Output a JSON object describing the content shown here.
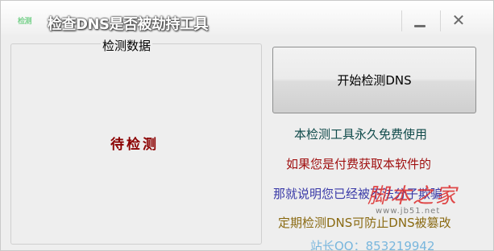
{
  "window": {
    "app_icon_label": "检测",
    "title": "检查DNS是否被劫持工具",
    "minimize_glyph": "—",
    "close_glyph": "✕"
  },
  "left_panel": {
    "legend": "检测数据",
    "status": "待检测"
  },
  "right_panel": {
    "start_button_label": "开始检测DNS",
    "info_lines": [
      "本检测工具永久免费使用",
      "如果您是付费获取本软件的",
      "那就说明您已经被不法分子欺骗",
      "定期检测DNS可防止DNS被篡改",
      "站长QQ：853219942"
    ]
  },
  "watermark": {
    "logo": "脚本之家",
    "url": "www.jb51.net"
  },
  "colors": {
    "status": "#8b0000",
    "line1": "#0f4a4a",
    "line2": "#a01010",
    "line3": "#3a3aa8",
    "line4": "#8a6a12",
    "watermark": "#dc2828"
  },
  "icons": {
    "minimize": "minimize-icon",
    "close": "close-icon",
    "app": "app-icon"
  }
}
